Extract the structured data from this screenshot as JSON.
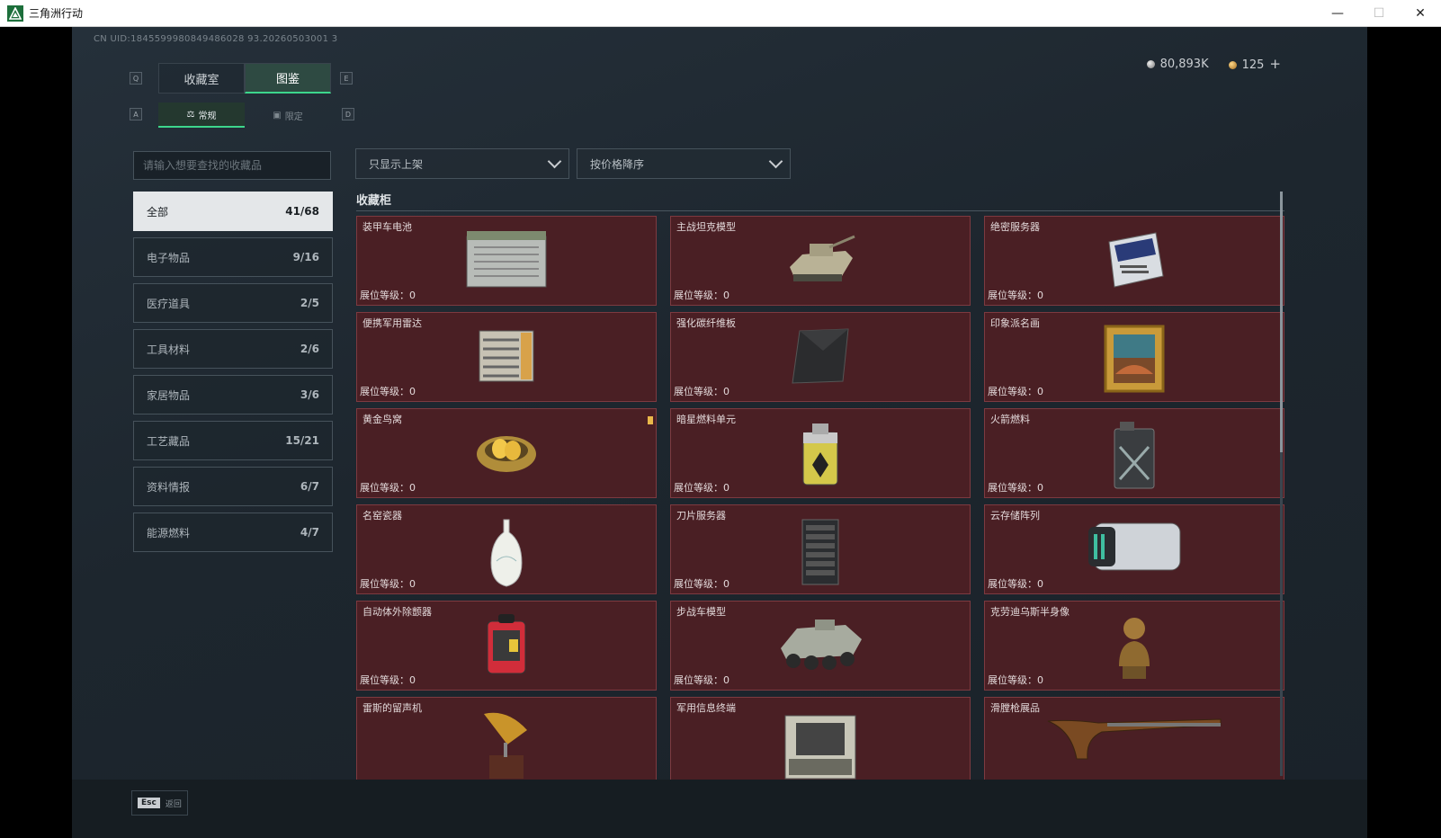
{
  "window": {
    "title": "三角洲行动",
    "minimize": "—",
    "maximize": "☐",
    "close": "✕"
  },
  "uid": "CN UID:1845599980849486028 93.20260503001 3",
  "currency": {
    "silver": "80,893K",
    "gold": "125",
    "gold_add": "+"
  },
  "key_hints": {
    "left_tab": "Q",
    "right_tab": "E",
    "left_sub": "A",
    "right_sub": "D"
  },
  "tabs": [
    {
      "label": "收藏室",
      "active": false
    },
    {
      "label": "图鉴",
      "active": true
    }
  ],
  "subtabs": [
    {
      "label": "常规",
      "icon": "flask-icon",
      "active": true
    },
    {
      "label": "限定",
      "icon": "image-icon",
      "active": false
    }
  ],
  "search": {
    "placeholder": "请输入想要查找的收藏品",
    "value": ""
  },
  "filters": {
    "shelf": "只显示上架",
    "sort": "按价格降序"
  },
  "categories": [
    {
      "label": "全部",
      "count": "41/68",
      "active": true
    },
    {
      "label": "电子物品",
      "count": "9/16"
    },
    {
      "label": "医疗道具",
      "count": "2/5"
    },
    {
      "label": "工具材料",
      "count": "2/6"
    },
    {
      "label": "家居物品",
      "count": "3/6"
    },
    {
      "label": "工艺藏品",
      "count": "15/21"
    },
    {
      "label": "资料情报",
      "count": "6/7"
    },
    {
      "label": "能源燃料",
      "count": "4/7"
    }
  ],
  "section_title": "收藏柜",
  "items": [
    {
      "name": "装甲车电池",
      "level": "展位等级：0",
      "icon": "battery-icon"
    },
    {
      "name": "主战坦克模型",
      "level": "展位等级：0",
      "icon": "tank-icon"
    },
    {
      "name": "绝密服务器",
      "level": "展位等级：0",
      "icon": "server-icon"
    },
    {
      "name": "便携军用雷达",
      "level": "展位等级：0",
      "icon": "radar-icon"
    },
    {
      "name": "强化碳纤维板",
      "level": "展位等级：0",
      "icon": "carbon-plate-icon"
    },
    {
      "name": "印象派名画",
      "level": "展位等级：0",
      "icon": "painting-icon"
    },
    {
      "name": "黄金鸟窝",
      "level": "展位等级：0",
      "icon": "golden-nest-icon",
      "badge": true
    },
    {
      "name": "暗星燃料单元",
      "level": "展位等级：0",
      "icon": "fuel-cell-icon"
    },
    {
      "name": "火箭燃料",
      "level": "展位等级：0",
      "icon": "jerrycan-icon"
    },
    {
      "name": "名窑瓷器",
      "level": "展位等级：0",
      "icon": "vase-icon"
    },
    {
      "name": "刀片服务器",
      "level": "展位等级：0",
      "icon": "blade-server-icon"
    },
    {
      "name": "云存储阵列",
      "level": "展位等级：0",
      "icon": "storage-array-icon"
    },
    {
      "name": "自动体外除颤器",
      "level": "展位等级：0",
      "icon": "defibrillator-icon"
    },
    {
      "name": "步战车模型",
      "level": "展位等级：0",
      "icon": "ifv-icon"
    },
    {
      "name": "克劳迪乌斯半身像",
      "level": "展位等级：0",
      "icon": "bust-icon"
    },
    {
      "name": "雷斯的留声机",
      "level": "",
      "icon": "gramophone-icon"
    },
    {
      "name": "军用信息终端",
      "level": "",
      "icon": "terminal-icon"
    },
    {
      "name": "滑膛枪展品",
      "level": "",
      "icon": "musket-icon"
    }
  ],
  "footer": {
    "esc_key": "Esc",
    "esc_label": "返回"
  }
}
